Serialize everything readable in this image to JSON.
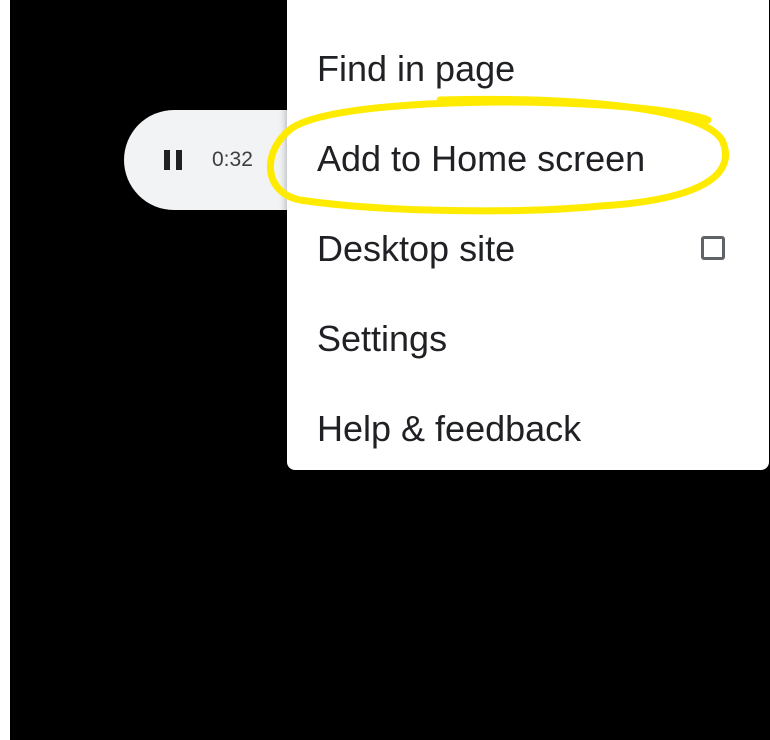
{
  "media_player": {
    "time": "0:32",
    "pause_icon": "pause-icon"
  },
  "menu": {
    "items": [
      {
        "label": "Find in page"
      },
      {
        "label": "Add to Home screen"
      },
      {
        "label": "Desktop site",
        "checkbox": true,
        "checked": false
      },
      {
        "label": "Settings"
      },
      {
        "label": "Help & feedback"
      }
    ]
  },
  "colors": {
    "background": "#000000",
    "menu_background": "#ffffff",
    "text": "#202124",
    "annotation": "#ffeb00"
  }
}
